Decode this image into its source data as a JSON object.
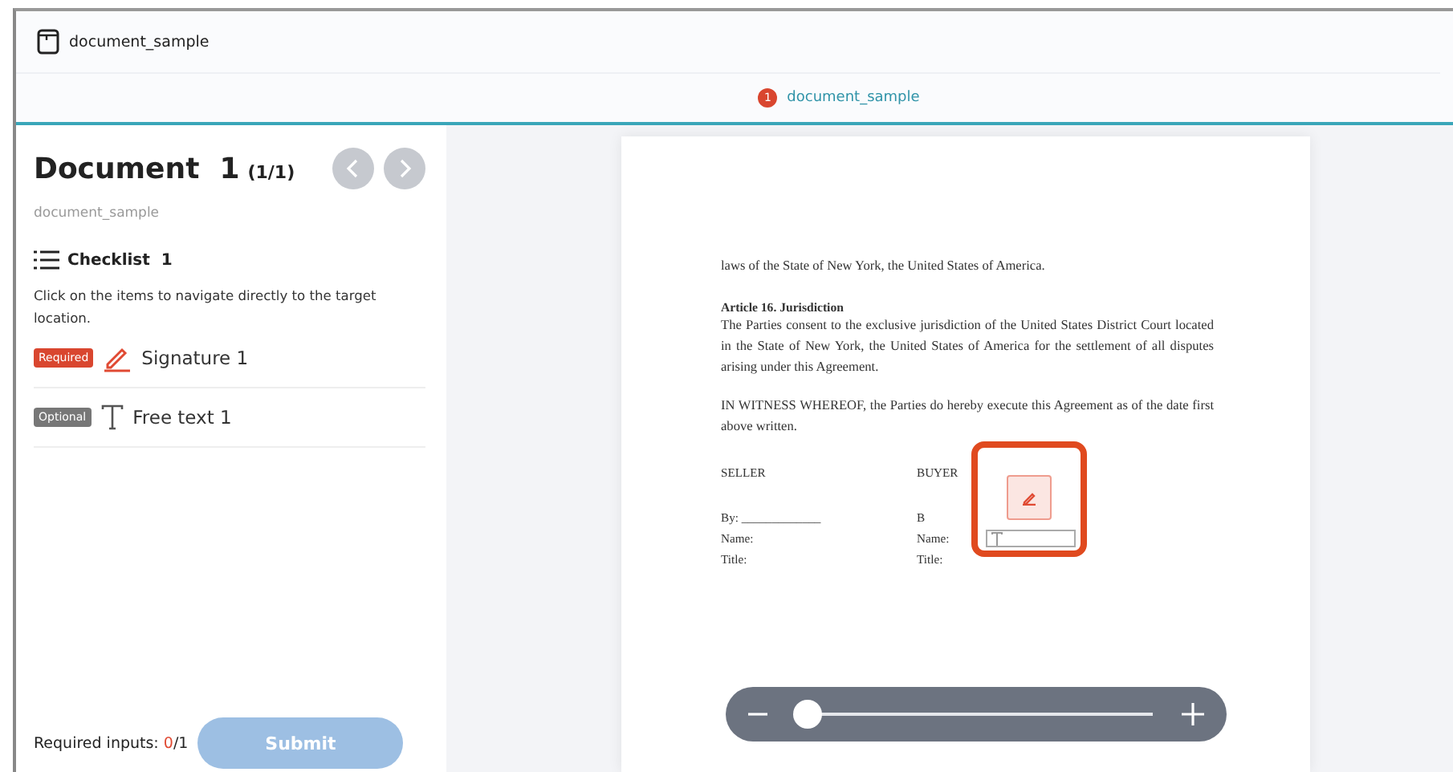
{
  "header": {
    "title": "document_sample"
  },
  "tabs": [
    {
      "badge": "1",
      "label": "document_sample",
      "selected": true
    }
  ],
  "sidebar": {
    "title": "Document",
    "number": "1",
    "count": "(1/1)",
    "subtitle": "document_sample",
    "nav": [
      {
        "kind": "prev",
        "disabled": true
      },
      {
        "kind": "next",
        "disabled": true
      }
    ],
    "checklist": {
      "label": "Checklist",
      "count": "1"
    },
    "hint": "Click on the items to navigate directly to the target location.",
    "items": [
      {
        "kind": "signature",
        "tag": "Required",
        "required": true,
        "label": "Signature 1"
      },
      {
        "kind": "text",
        "tag": "Optional",
        "required": false,
        "label": "Free text 1"
      }
    ],
    "footer": {
      "label": "Required inputs:",
      "filled": "0",
      "total": "/1"
    },
    "submit": {
      "label": "Submit",
      "disabled": true
    }
  },
  "document": {
    "intro": "laws of the State of New York, the United States of America.",
    "heading": "Article 16. Jurisdiction",
    "paragraphs": [
      "The Parties consent to the exclusive jurisdiction of the United States District Court located in the State of New York, the United States of America for the settlement of all disputes arising under this Agreement.",
      "IN WITNESS WHEREOF, the Parties do hereby execute this Agreement as of the date first above written."
    ],
    "parties": [
      {
        "role": "SELLER",
        "lines": [
          "By: _____________",
          "Name:",
          "Title:"
        ]
      },
      {
        "role": "BUYER",
        "lines": [
          "B",
          "Name:",
          "Title:"
        ]
      }
    ],
    "fields": {
      "highlighted": true
    }
  },
  "zoom": {
    "level": 0.03
  }
}
